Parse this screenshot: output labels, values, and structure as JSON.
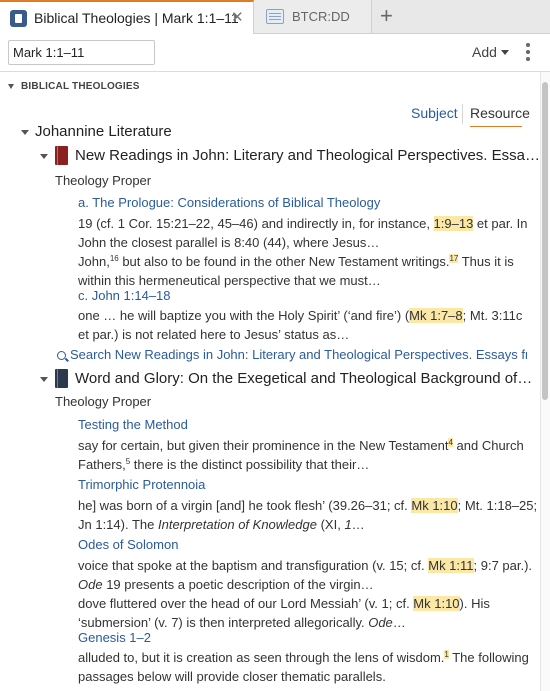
{
  "tabs": [
    {
      "label": "Biblical Theologies | Mark 1:1–11",
      "close": "✕"
    },
    {
      "label": "BTCR:DD"
    }
  ],
  "new_tab_label": "+",
  "toolbar": {
    "reference_value": "Mark 1:1–11",
    "add_label": "Add"
  },
  "section": {
    "title": "BIBLICAL THEOLOGIES"
  },
  "sort": {
    "subject": "Subject",
    "resource": "Resource",
    "selected": "Resource"
  },
  "group": {
    "title": "Johannine Literature"
  },
  "resources": [
    {
      "title": "New Readings in John: Literary and Theological Perspectives. Essa…",
      "book_color": "#8a2020",
      "subject": "Theology Proper",
      "entries": [
        {
          "heading": "a. The Prologue: Considerations of Biblical Theology",
          "lines": [
            [
              "19 (cf. 1 Cor. 15:21–22, 45–46) and indirectly in, for instance, ",
              "1:9–13",
              " et par. In"
            ],
            [
              "John the closest parallel is 8:40 (44), where Jesus…"
            ],
            [
              "John,",
              "16",
              " but also to be found in the other New Testament writings.",
              "17",
              " Thus it is"
            ],
            [
              "within this hermeneutical perspective that we must…"
            ]
          ]
        },
        {
          "heading": "c. John 1:14–18",
          "lines": [
            [
              "one … he will baptize you with the Holy Spirit’ (‘and fire’) (",
              "Mk 1:7–8",
              "; Mt. 3:11c"
            ],
            [
              "et par.) is not related here to Jesus’ status as…"
            ]
          ]
        }
      ],
      "search_label": "Search New Readings in John: Literary and Theological Perspectives. Essays from"
    },
    {
      "title": "Word and Glory: On the Exegetical and Theological Background of…",
      "book_color": "#2d3a4e",
      "subject": "Theology Proper",
      "entries": [
        {
          "heading": "Testing the Method",
          "lines": [
            [
              "say for certain, but given their prominence in the New Testament",
              "4",
              " and Church"
            ],
            [
              "Fathers,",
              "5",
              " there is the distinct possibility that their…"
            ]
          ]
        },
        {
          "heading": "Trimorphic Protennoia",
          "lines": [
            [
              "he] was born of a virgin [and] he took flesh’ (39.26–31; cf. ",
              "Mk 1:10",
              "; Mt. 1:18–25;"
            ],
            [
              "Jn 1:14). The ",
              "Interpretation of Knowledge",
              " (XI, ",
              "1",
              "…"
            ]
          ]
        },
        {
          "heading": "Odes of Solomon",
          "lines": [
            [
              "voice that spoke at the baptism and transfiguration (v. 15; cf. ",
              "Mk 1:11",
              "; 9:7 par.)."
            ],
            [
              "Ode",
              " 19 presents a poetic description of the virgin…"
            ],
            [
              "dove fluttered over the head of our Lord Messiah’ (v. 1; cf. ",
              "Mk 1:10",
              "). His"
            ],
            [
              "‘submersion’ (v. 7) is then interpreted allegorically. ",
              "Ode",
              "…"
            ]
          ]
        },
        {
          "heading": "Genesis 1–2",
          "lines": [
            [
              "alluded to, but it is creation as seen through the lens of wisdom.",
              "1",
              " The following"
            ],
            [
              "passages below will provide closer thematic parallels."
            ]
          ]
        }
      ]
    }
  ],
  "colors": {
    "accent": "#e07b26",
    "link": "#2a5b9c",
    "highlight": "#fce8a6"
  }
}
